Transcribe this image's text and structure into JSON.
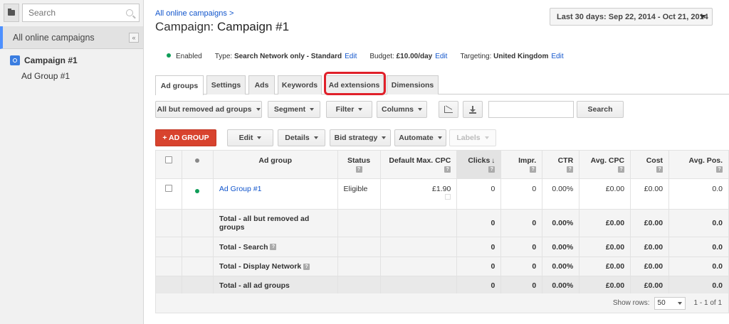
{
  "sidebar": {
    "search_placeholder": "Search",
    "all_label": "All online campaigns",
    "collapse_label": "«",
    "campaign": "Campaign #1",
    "adgroup": "Ad Group #1"
  },
  "header": {
    "breadcrumb": "All online campaigns >",
    "title_prefix": "Campaign:",
    "title_name": "Campaign #1",
    "date_range": "Last 30 days: Sep 22, 2014 - Oct 21, 2014"
  },
  "info": {
    "status": "Enabled",
    "type_label": "Type:",
    "type_value": "Search Network only - Standard",
    "budget_label": "Budget:",
    "budget_value": "£10.00/day",
    "targeting_label": "Targeting:",
    "targeting_value": "United Kingdom",
    "edit": "Edit"
  },
  "tabs": [
    "Ad groups",
    "Settings",
    "Ads",
    "Keywords",
    "Ad extensions",
    "Dimensions"
  ],
  "toolbar": {
    "filter_view": "All but removed ad groups",
    "segment": "Segment",
    "filter": "Filter",
    "columns": "Columns",
    "search_btn": "Search",
    "add_group": "+ AD GROUP",
    "edit": "Edit",
    "details": "Details",
    "bid_strategy": "Bid strategy",
    "automate": "Automate",
    "labels": "Labels"
  },
  "table": {
    "headers": [
      "Ad group",
      "Status",
      "Default Max. CPC",
      "Clicks",
      "Impr.",
      "CTR",
      "Avg. CPC",
      "Cost",
      "Avg. Pos."
    ],
    "help": "?",
    "sort_arrow": "↓",
    "row": {
      "name": "Ad Group #1",
      "status": "Eligible",
      "cpc": "£1.90",
      "clicks": "0",
      "impr": "0",
      "ctr": "0.00%",
      "avg_cpc": "£0.00",
      "cost": "£0.00",
      "avg_pos": "0.0"
    },
    "totals": [
      {
        "label": "Total - all but removed ad groups",
        "clicks": "0",
        "impr": "0",
        "ctr": "0.00%",
        "avg_cpc": "£0.00",
        "cost": "£0.00",
        "avg_pos": "0.0"
      },
      {
        "label": "Total - Search",
        "clicks": "0",
        "impr": "0",
        "ctr": "0.00%",
        "avg_cpc": "£0.00",
        "cost": "£0.00",
        "avg_pos": "0.0"
      },
      {
        "label": "Total - Display Network",
        "clicks": "0",
        "impr": "0",
        "ctr": "0.00%",
        "avg_cpc": "£0.00",
        "cost": "£0.00",
        "avg_pos": "0.0"
      },
      {
        "label": "Total - all ad groups",
        "clicks": "0",
        "impr": "0",
        "ctr": "0.00%",
        "avg_cpc": "£0.00",
        "cost": "£0.00",
        "avg_pos": "0.0"
      }
    ]
  },
  "footer": {
    "show_rows": "Show rows:",
    "rows_value": "50",
    "range": "1 - 1 of 1"
  },
  "colors": {
    "accent": "#1155cc",
    "highlight": "#e0202a",
    "add_button": "#d8432e",
    "enabled": "#0f9d58"
  }
}
